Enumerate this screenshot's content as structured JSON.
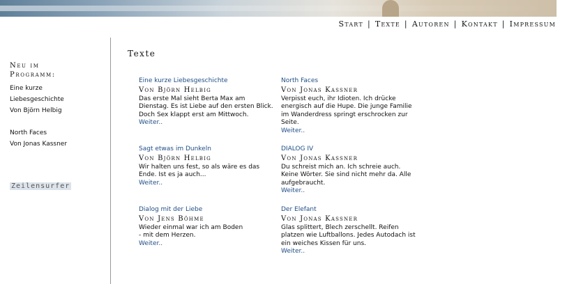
{
  "nav": {
    "start": "Start",
    "texte": "Texte",
    "autoren": "Autoren",
    "kontakt": "Kontakt",
    "impressum": "Impressum",
    "separator": "|"
  },
  "sidebar": {
    "heading_line1": "Neu im",
    "heading_line2": "Programm:",
    "link1_line1": "Eine kurze",
    "link1_line2": "Liebesgeschichte",
    "link1_line3": "Von Björn Helbig",
    "link2_line1": "North Faces",
    "link2_line2": "Von Jonas Kassner",
    "brand": "Zeilensurfer"
  },
  "main": {
    "title": "Texte",
    "entries": [
      {
        "title": "Eine kurze Liebesgeschichte",
        "author": "Von Björn Helbig",
        "teaser": "Das erste Mal sieht Berta Max am Dienstag. Es ist Liebe auf den ersten Blick. Doch Sex klappt erst am Mittwoch.",
        "more": "Weiter.."
      },
      {
        "title": "North Faces",
        "author": "Von Jonas Kassner",
        "teaser": "Verpisst euch, ihr Idioten. Ich drücke energisch auf die Hupe. Die junge Familie im Wanderdress springt erschrocken zur Seite.",
        "more": "Weiter.."
      },
      {
        "title": "Sagt etwas im Dunkeln",
        "author": "Von Björn Helbig",
        "teaser": "Wir halten uns fest, so als wäre es das Ende. Ist es ja auch...",
        "more": "Weiter.."
      },
      {
        "title": "DIALOG IV",
        "author": "Von Jonas Kassner",
        "teaser": "Du schreist mich an. Ich schreie auch. Keine Wörter. Sie sind nicht mehr da. Alle aufgebraucht.",
        "more": "Weiter.."
      },
      {
        "title": "Dialog mit der Liebe",
        "author": "Von Jens Böhme",
        "teaser_line1": "Wieder einmal war ich am Boden",
        "teaser_line2": "- mit dem Herzen.",
        "more": "Weiter.."
      },
      {
        "title": "Der Elefant",
        "author": "Von Jonas Kassner",
        "teaser": "Glas splittert, Blech zerschellt. Reifen platzen wie Luftballons. Jedes Autodach ist ein weiches Kissen für uns.",
        "more": "Weiter.."
      }
    ]
  }
}
